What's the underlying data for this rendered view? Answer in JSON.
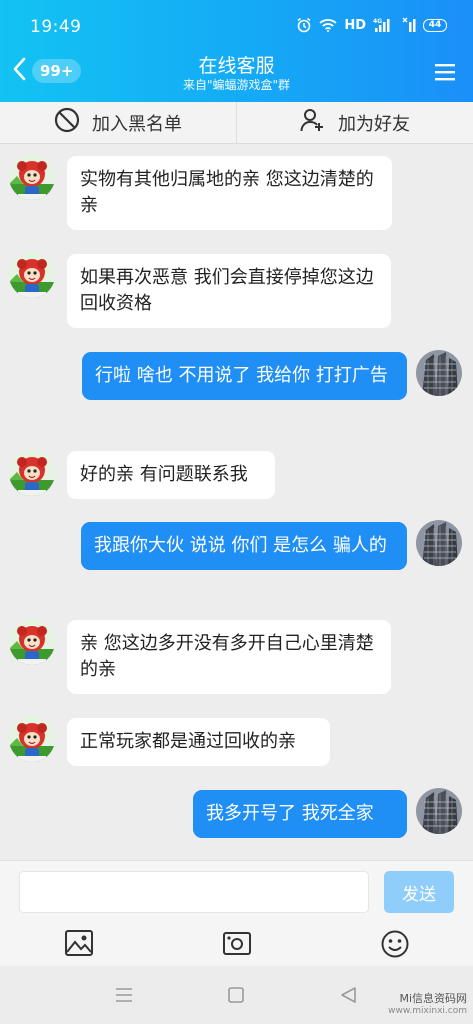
{
  "status_bar": {
    "time": "19:49",
    "network": "HD",
    "signal_tag": "4G",
    "battery": "44"
  },
  "header": {
    "unread_count": "99+",
    "title": "在线客服",
    "subtitle": "来自\"蝙蝠游戏盒\"群",
    "back_icon": "chevron-left-icon",
    "menu_icon": "hamburger-menu-icon"
  },
  "actions": {
    "block_label": "加入黑名单",
    "add_friend_label": "加为好友"
  },
  "messages": [
    {
      "side": "in",
      "text": "实物有其他归属地的亲 您这边清楚的亲"
    },
    {
      "side": "in",
      "text": "如果再次恶意 我们会直接停掉您这边回收资格"
    },
    {
      "side": "out",
      "text": "行啦 啥也 不用说了 我给你 打打广告"
    },
    {
      "side": "in",
      "text": "好的亲 有问题联系我"
    },
    {
      "side": "out",
      "text": "我跟你大伙 说说 你们 是怎么 骗人的"
    },
    {
      "side": "in",
      "text": "亲 您这边多开没有多开自己心里清楚的亲"
    },
    {
      "side": "in",
      "text": "正常玩家都是通过回收的亲"
    },
    {
      "side": "out",
      "text": "我多开号了 我死全家"
    }
  ],
  "input": {
    "value": "",
    "placeholder": "",
    "send_label": "发送"
  },
  "watermark": {
    "name": "Mi信息资码网",
    "url": "www.mixinxi.com"
  },
  "colors": {
    "header_start": "#13c3f3",
    "header_end": "#1a8ff8",
    "out_bubble": "#1f8ef5",
    "send_button": "#8fcdfa"
  }
}
